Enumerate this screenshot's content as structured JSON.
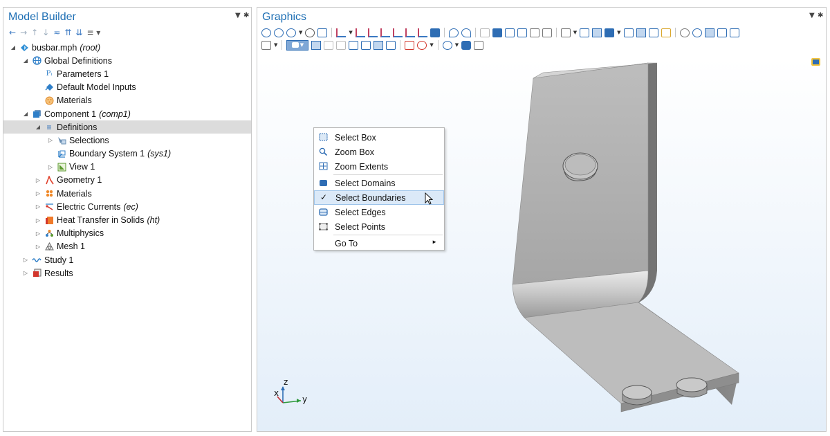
{
  "model_builder": {
    "title": "Model Builder",
    "toolbar_icons": [
      "arrow-left-icon",
      "arrow-right-icon",
      "arrow-up-icon",
      "arrow-down-icon",
      "show-more-icon",
      "expand-icon",
      "collapse-icon",
      "list-dropdown-icon"
    ],
    "tree": [
      {
        "label": "busbar.mph",
        "suffix": "(root)",
        "level": 0,
        "expanded": true,
        "icon": "model-root-icon"
      },
      {
        "label": "Global Definitions",
        "suffix": "",
        "level": 1,
        "expanded": true,
        "icon": "globe-icon"
      },
      {
        "label": "Parameters 1",
        "suffix": "",
        "level": 2,
        "expanded": null,
        "icon": "parameters-icon"
      },
      {
        "label": "Default Model Inputs",
        "suffix": "",
        "level": 2,
        "expanded": null,
        "icon": "model-inputs-icon"
      },
      {
        "label": "Materials",
        "suffix": "",
        "level": 2,
        "expanded": null,
        "icon": "materials-icon"
      },
      {
        "label": "Component 1",
        "suffix": "(comp1)",
        "level": 1,
        "expanded": true,
        "icon": "component-icon"
      },
      {
        "label": "Definitions",
        "suffix": "",
        "level": 2,
        "expanded": true,
        "icon": "definitions-icon",
        "selected": true
      },
      {
        "label": "Selections",
        "suffix": "",
        "level": 3,
        "expanded": false,
        "icon": "selections-icon"
      },
      {
        "label": "Boundary System 1",
        "suffix": "(sys1)",
        "level": 3,
        "expanded": null,
        "icon": "boundary-system-icon"
      },
      {
        "label": "View 1",
        "suffix": "",
        "level": 3,
        "expanded": false,
        "icon": "view-icon"
      },
      {
        "label": "Geometry 1",
        "suffix": "",
        "level": 2,
        "expanded": false,
        "icon": "geometry-icon"
      },
      {
        "label": "Materials",
        "suffix": "",
        "level": 2,
        "expanded": false,
        "icon": "materials-icon"
      },
      {
        "label": "Electric Currents",
        "suffix": "(ec)",
        "level": 2,
        "expanded": false,
        "icon": "electric-currents-icon"
      },
      {
        "label": "Heat Transfer in Solids",
        "suffix": "(ht)",
        "level": 2,
        "expanded": false,
        "icon": "heat-transfer-icon"
      },
      {
        "label": "Multiphysics",
        "suffix": "",
        "level": 2,
        "expanded": false,
        "icon": "multiphysics-icon"
      },
      {
        "label": "Mesh 1",
        "suffix": "",
        "level": 2,
        "expanded": false,
        "icon": "mesh-icon"
      },
      {
        "label": "Study 1",
        "suffix": "",
        "level": 1,
        "expanded": false,
        "icon": "study-icon"
      },
      {
        "label": "Results",
        "suffix": "",
        "level": 1,
        "expanded": false,
        "icon": "results-icon"
      }
    ]
  },
  "graphics": {
    "title": "Graphics",
    "axes": {
      "x": "x",
      "y": "y",
      "z": "z"
    }
  },
  "context_menu": {
    "items": [
      {
        "label": "Select Box",
        "icon": "select-box-icon",
        "checked": false
      },
      {
        "label": "Zoom Box",
        "icon": "zoom-box-icon",
        "checked": false
      },
      {
        "label": "Zoom Extents",
        "icon": "zoom-extents-icon",
        "checked": false,
        "separator_after": true
      },
      {
        "label": "Select Domains",
        "icon": "select-domains-icon",
        "checked": false
      },
      {
        "label": "Select Boundaries",
        "icon": "",
        "checked": true,
        "highlighted": true
      },
      {
        "label": "Select Edges",
        "icon": "select-edges-icon",
        "checked": false
      },
      {
        "label": "Select Points",
        "icon": "select-points-icon",
        "checked": false,
        "separator_after": true
      },
      {
        "label": "Go To",
        "icon": "",
        "checked": false,
        "submenu": true
      }
    ],
    "check_glyph": "✓"
  },
  "colors": {
    "accent": "#1e6fb4",
    "selection_bg": "#dcdcdc",
    "menu_highlight": "#dbe9f8"
  }
}
